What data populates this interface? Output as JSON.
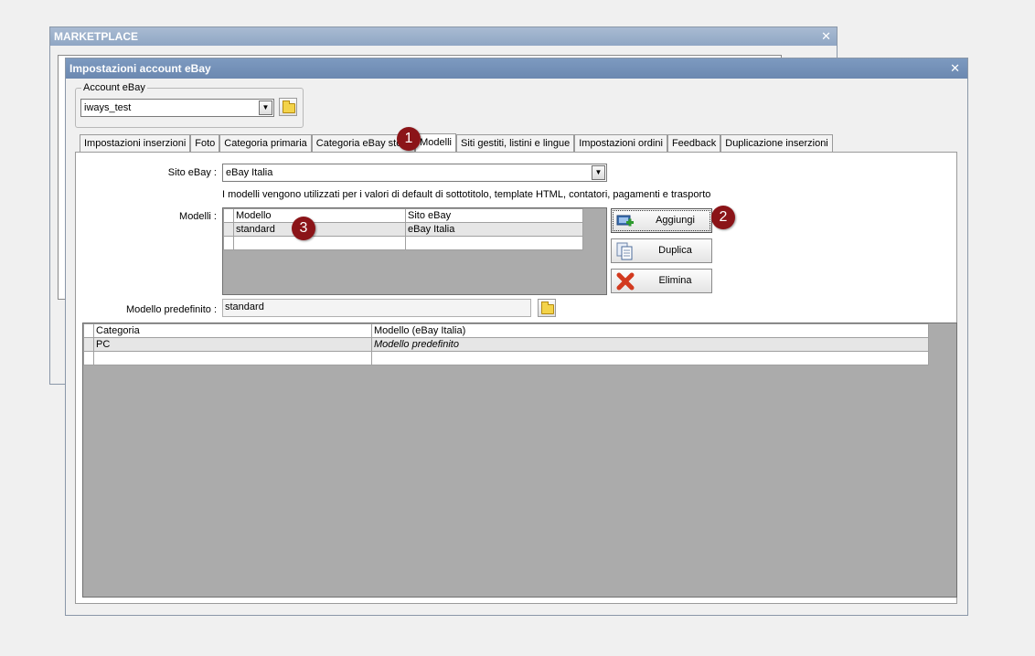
{
  "background_window": {
    "title": "MARKETPLACE",
    "close_glyph": "✕"
  },
  "window": {
    "title": "Impostazioni account eBay",
    "close_glyph": "✕"
  },
  "account_group": {
    "legend": "Account eBay",
    "value": "iways_test"
  },
  "tabs": [
    {
      "label": "Impostazioni inserzioni"
    },
    {
      "label": "Foto"
    },
    {
      "label": "Categoria primaria"
    },
    {
      "label": "Categoria eBay store"
    },
    {
      "label": "Modelli",
      "active": true
    },
    {
      "label": "Siti gestiti, listini e lingue"
    },
    {
      "label": "Impostazioni ordini"
    },
    {
      "label": "Feedback"
    },
    {
      "label": "Duplicazione inserzioni"
    }
  ],
  "site": {
    "label": "Sito eBay :",
    "value": "eBay Italia"
  },
  "info_text": "I modelli vengono utilizzati per i valori di default di sottotitolo, template HTML, contatori, pagamenti e trasporto",
  "models": {
    "label": "Modelli :",
    "columns": [
      "Modello",
      "Sito eBay"
    ],
    "rows": [
      [
        "standard",
        "eBay Italia"
      ]
    ]
  },
  "buttons": {
    "add": "Aggiungi",
    "duplicate": "Duplica",
    "delete": "Elimina"
  },
  "default_model": {
    "label": "Modello predefinito :",
    "value": "standard"
  },
  "category_grid": {
    "columns": [
      "Categoria",
      "Modello (eBay Italia)"
    ],
    "rows": [
      [
        "PC",
        "Modello predefinito"
      ]
    ]
  },
  "badges": [
    "1",
    "2",
    "3"
  ],
  "colors": {
    "badge": "#8b1418",
    "titlebar": "#6b88b0",
    "grid_bg": "#ababab"
  },
  "icons": {
    "dropdown": "▼",
    "folder": "folder-icon",
    "add": "add-model-icon",
    "duplicate": "duplicate-icon",
    "delete": "delete-x-icon"
  }
}
